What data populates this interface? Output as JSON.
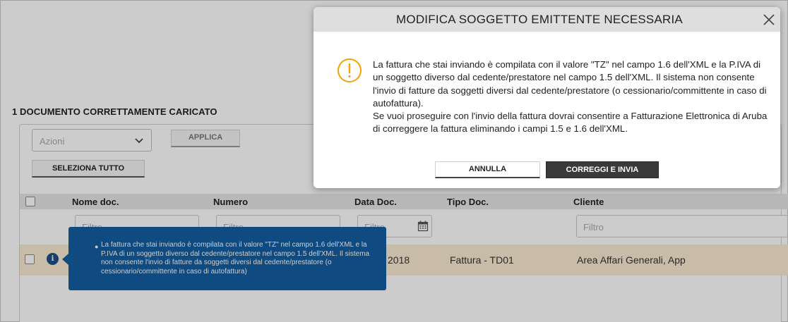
{
  "page": {
    "title": "1 DOCUMENTO CORRETTAMENTE CARICATO",
    "actions_select": {
      "placeholder": "Azioni"
    },
    "apply_label": "APPLICA",
    "select_all_label": "SELEZIONA TUTTO"
  },
  "table": {
    "columns": [
      "Nome doc.",
      "Numero",
      "Data Doc.",
      "Tipo Doc.",
      "Cliente"
    ],
    "filter_placeholder": "Filtro",
    "rows": [
      {
        "data_doc": "2018",
        "tipo_doc": "Fattura - TD01",
        "cliente": "Area Affari Generali, App"
      }
    ]
  },
  "tooltip": {
    "text": "La fattura che stai inviando è compilata con il valore \"TZ\" nel campo 1.6 dell'XML e la P.IVA di un soggetto diverso dal cedente/prestatore nel campo 1.5 dell'XML. Il sistema non consente l'invio di fatture da soggetti diversi dal cedente/prestatore (o cessionario/committente in caso di autofattura)"
  },
  "modal": {
    "title": "MODIFICA SOGGETTO EMITTENTE NECESSARIA",
    "paragraph1": "La fattura che stai inviando è compilata con il valore \"TZ\" nel campo 1.6 dell'XML e la P.IVA di un soggetto diverso dal cedente/prestatore nel campo 1.5 dell'XML. Il sistema non consente l'invio di fatture da soggetti diversi dal cedente/prestatore (o cessionario/committente in caso di autofattura).",
    "paragraph2": "Se vuoi proseguire con l'invio della fattura dovrai consentire a Fatturazione Elettronica di Aruba di correggere la fattura eliminando i campi 1.5 e 1.6 dell'XML.",
    "cancel_label": "ANNULLA",
    "confirm_label": "CORREGGI E INVIA"
  },
  "colors": {
    "warning": "#f0a30a",
    "tooltip_bg": "#135ea0",
    "row_highlight": "#faecd4",
    "primary_button": "#3a3a3a"
  },
  "icons": [
    "chevron-down-icon",
    "calendar-icon",
    "info-icon",
    "warning-icon",
    "close-icon"
  ]
}
